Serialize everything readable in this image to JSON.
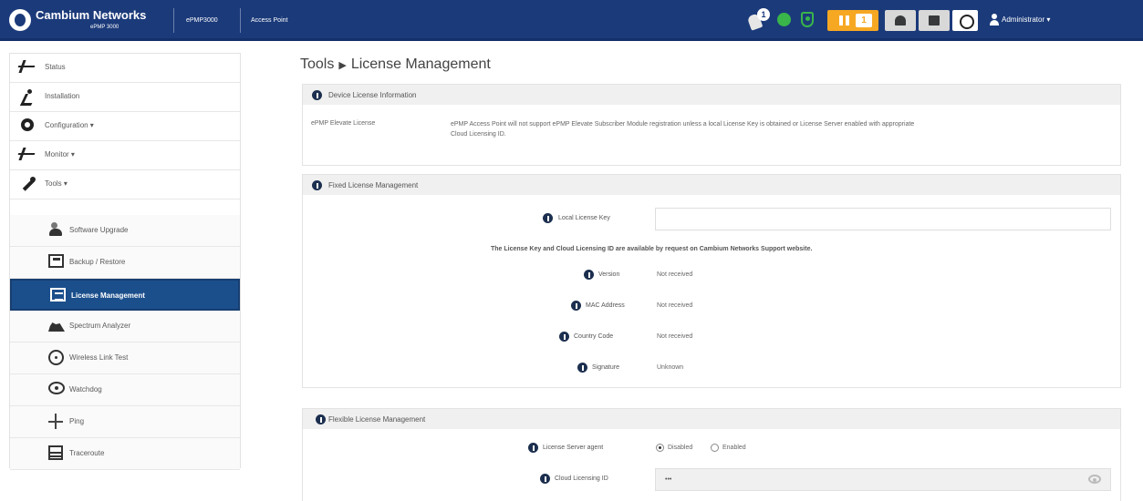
{
  "header": {
    "brand": "Cambium Networks",
    "product": "ePMP 3000",
    "device": "ePMP3000",
    "mode": "Access Point",
    "notification_count": "1",
    "warning_count": "1",
    "user": "Administrator ▾"
  },
  "sidebar": {
    "items": [
      {
        "label": "Status",
        "icon": "pulse-icon"
      },
      {
        "label": "Installation",
        "icon": "running-person-icon"
      },
      {
        "label": "Configuration ▾",
        "icon": "gear-icon"
      },
      {
        "label": "Monitor ▾",
        "icon": "pulse-icon"
      },
      {
        "label": "Tools ▾",
        "icon": "wrench-icon"
      }
    ],
    "sub_items": [
      {
        "label": "Software Upgrade",
        "icon": "upgrade-icon"
      },
      {
        "label": "Backup / Restore",
        "icon": "backup-icon"
      },
      {
        "label": "License Management",
        "icon": "license-icon"
      },
      {
        "label": "Spectrum Analyzer",
        "icon": "spectrum-icon"
      },
      {
        "label": "Wireless Link Test",
        "icon": "wireless-icon"
      },
      {
        "label": "Watchdog",
        "icon": "watchdog-icon"
      },
      {
        "label": "Ping",
        "icon": "ping-icon"
      },
      {
        "label": "Traceroute",
        "icon": "traceroute-icon"
      }
    ]
  },
  "page": {
    "breadcrumb_root": "Tools",
    "breadcrumb_page": "License Management"
  },
  "device_license": {
    "title": "Device License Information",
    "label": "ePMP Elevate License",
    "text": "ePMP Access Point will not support ePMP Elevate Subscriber Module registration unless a local License Key is obtained or License Server enabled with appropriate Cloud Licensing ID."
  },
  "fixed_license": {
    "title": "Fixed License Management",
    "local_key_label": "Local License Key",
    "local_key_value": "",
    "notice": "The License Key and Cloud Licensing ID are available by request on Cambium Networks Support website.",
    "fields": [
      {
        "label": "Version",
        "value": "Not received"
      },
      {
        "label": "MAC Address",
        "value": "Not received"
      },
      {
        "label": "Country Code",
        "value": "Not received"
      },
      {
        "label": "Signature",
        "value": "Unknown"
      }
    ]
  },
  "flexible_license": {
    "title": "Flexible License Management",
    "server_label": "License Server agent",
    "options": [
      "Disabled",
      "Enabled"
    ],
    "selected": "Disabled",
    "cloud_label": "Cloud Licensing ID",
    "cloud_value": "•••"
  }
}
